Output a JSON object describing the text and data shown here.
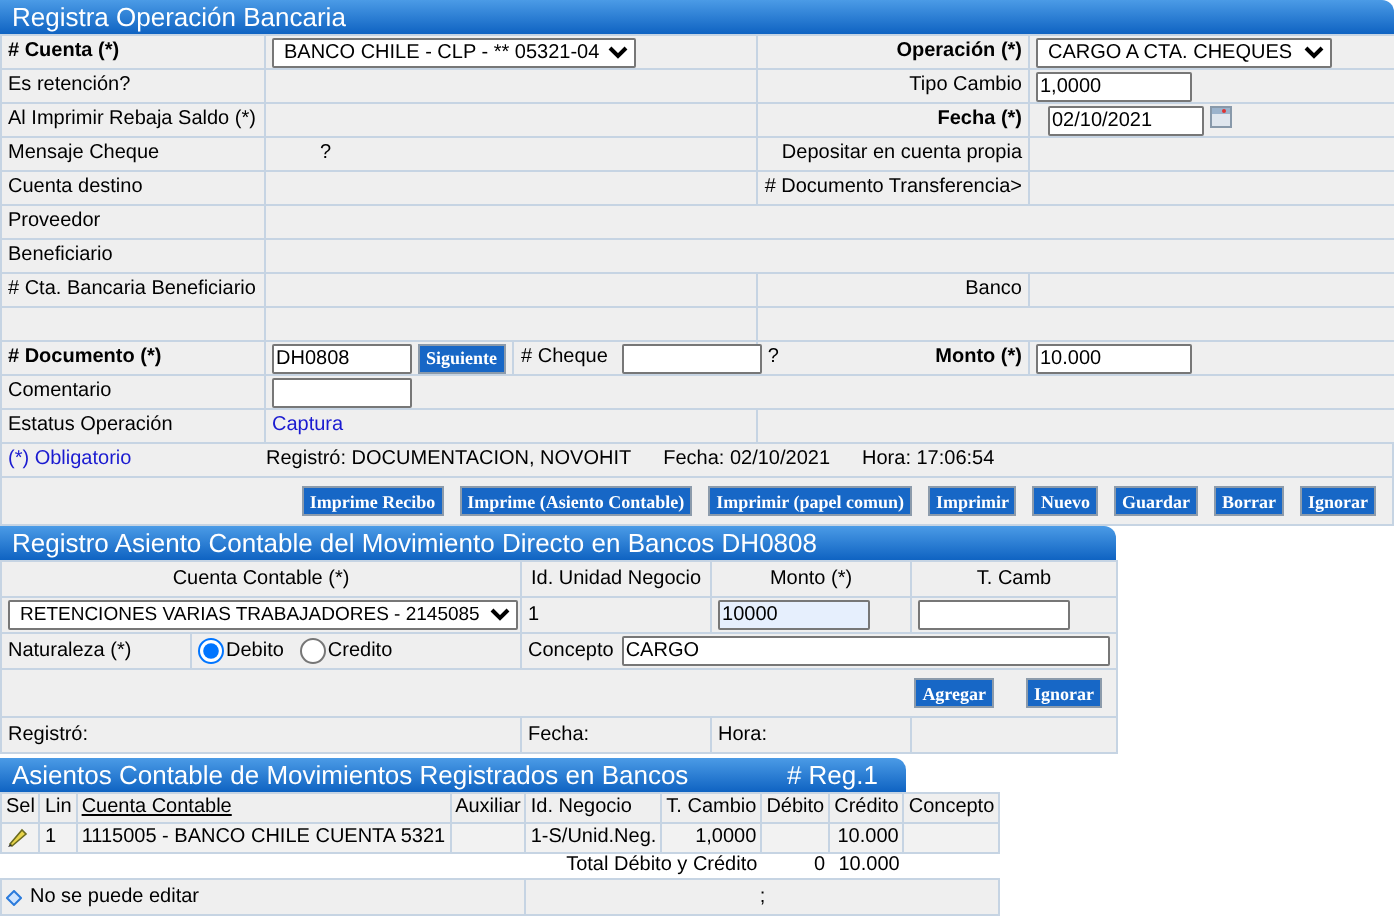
{
  "operation": {
    "title": "Registra Operación Bancaria",
    "rows": [
      {
        "cells": [
          {
            "kind": "label",
            "text": "# Cuenta (*)",
            "bold": true
          },
          {
            "kind": "field",
            "items": [
              {
                "kind": "select",
                "value": "BANCO CHILE - CLP - ** 05321-04"
              }
            ]
          },
          {
            "kind": "label",
            "text": "Operación (*)",
            "bold": true
          },
          {
            "kind": "field",
            "items": [
              {
                "kind": "select",
                "value": "CARGO A CTA. CHEQUES"
              }
            ]
          }
        ]
      },
      {
        "cells": [
          {
            "kind": "label",
            "text": "Es retención?"
          },
          {
            "kind": "blank"
          },
          {
            "kind": "label",
            "text": "Tipo Cambio"
          },
          {
            "kind": "field",
            "items": [
              {
                "kind": "input",
                "value": "1,0000"
              }
            ]
          }
        ]
      },
      {
        "cells": [
          {
            "kind": "label",
            "text": "Al Imprimir Rebaja Saldo (*)"
          },
          {
            "kind": "blank"
          },
          {
            "kind": "label",
            "text": "Fecha (*)",
            "bold": true
          },
          {
            "kind": "field",
            "items": [
              {
                "kind": "date",
                "value": "02/10/2021"
              }
            ]
          }
        ]
      },
      {
        "cells": [
          {
            "kind": "label",
            "text": "Mensaje Cheque"
          },
          {
            "kind": "field",
            "items": [
              {
                "kind": "hint",
                "text": "?"
              }
            ]
          },
          {
            "kind": "label",
            "text": "Depositar en cuenta propia"
          },
          {
            "kind": "blank"
          }
        ]
      },
      {
        "cells": [
          {
            "kind": "label",
            "text": "Cuenta destino"
          },
          {
            "kind": "blank"
          },
          {
            "kind": "label",
            "text": "# Documento Transferencia>"
          },
          {
            "kind": "blank"
          }
        ]
      },
      {
        "cells": [
          {
            "kind": "label",
            "text": "Proveedor"
          },
          {
            "kind": "blank"
          }
        ]
      },
      {
        "cells": [
          {
            "kind": "label",
            "text": "Beneficiario"
          },
          {
            "kind": "blank"
          }
        ]
      },
      {
        "cells": [
          {
            "kind": "label",
            "text": "# Cta. Bancaria Beneficiario"
          },
          {
            "kind": "blank"
          },
          {
            "kind": "label",
            "text": "Banco"
          },
          {
            "kind": "blank"
          }
        ]
      },
      {
        "cells": [
          {
            "kind": "blank"
          },
          {
            "kind": "blank"
          },
          {
            "kind": "blank"
          }
        ]
      },
      {
        "cells": [
          {
            "kind": "label",
            "text": "# Documento (*)",
            "bold": true
          },
          {
            "kind": "field",
            "items": [
              {
                "kind": "input",
                "value": "DH0808"
              },
              {
                "kind": "button",
                "label": "Siguiente"
              },
              {
                "kind": "sublabel",
                "text": "# Cheque"
              },
              {
                "kind": "input"
              },
              {
                "kind": "hint",
                "text": "?"
              }
            ]
          },
          {
            "kind": "label",
            "text": "Monto (*)",
            "bold": true
          },
          {
            "kind": "field",
            "items": [
              {
                "kind": "input",
                "value": "10.000"
              }
            ]
          }
        ]
      },
      {
        "cells": [
          {
            "kind": "label",
            "text": "Comentario"
          },
          {
            "kind": "field",
            "items": [
              {
                "kind": "wide-input"
              }
            ]
          }
        ]
      },
      {
        "cells": [
          {
            "kind": "label",
            "text": "Estatus Operación"
          },
          {
            "kind": "label",
            "text": "Captura",
            "accent": true
          },
          {
            "kind": "blank"
          }
        ]
      }
    ],
    "footer": {
      "note": "(*) Obligatorio",
      "info": [
        "Registró: DOCUMENTACION, NOVOHIT",
        "Fecha: 02/10/2021",
        "Hora: 17:06:54"
      ]
    },
    "buttons": [
      "Imprime Recibo",
      "Imprime (Asiento Contable)",
      "Imprimir (papel comun)",
      "Imprimir",
      "Nuevo",
      "Guardar",
      "Borrar",
      "Ignorar"
    ]
  },
  "entry": {
    "title": "Registro Asiento Contable del Movimiento Directo en Bancos DH0808",
    "columns": [
      "Cuenta Contable (*)",
      "Id. Unidad Negocio",
      "Monto (*)",
      "T. Camb"
    ],
    "account": "RETENCIONES VARIAS TRABAJADORES - 2145085",
    "unit": "1",
    "amount": "10000",
    "nature": {
      "label": "Naturaleza (*)",
      "options": [
        {
          "label": "Debito",
          "selected": true
        },
        {
          "label": "Credito",
          "selected": false
        }
      ]
    },
    "concept": {
      "label": "Concepto",
      "value": "CARGO"
    },
    "buttons": [
      "Agregar",
      "Ignorar"
    ],
    "footer": [
      "Registró:",
      "Fecha:",
      "Hora:"
    ]
  },
  "registered": {
    "title": "Asientos Contable de Movimientos Registrados en Bancos",
    "count": "# Reg.1",
    "columns": [
      {
        "label": "Sel"
      },
      {
        "label": "Lin"
      },
      {
        "label": "Cuenta Contable",
        "link": true
      },
      {
        "label": "Auxiliar"
      },
      {
        "label": "Id. Negocio"
      },
      {
        "label": "T. Cambio"
      },
      {
        "label": "Débito"
      },
      {
        "label": "Crédito"
      },
      {
        "label": "Concepto"
      }
    ],
    "rows": [
      {
        "line": "1",
        "account": "1115005 - BANCO CHILE CUENTA 5321",
        "business": "1-S/Unid.Neg.",
        "rate": "1,0000",
        "credit": "10.000"
      }
    ],
    "totals": {
      "label": "Total Débito y Crédito",
      "debit": "0",
      "credit": "10.000"
    },
    "legend": "No se puede editar",
    "footer_mark": ";"
  }
}
